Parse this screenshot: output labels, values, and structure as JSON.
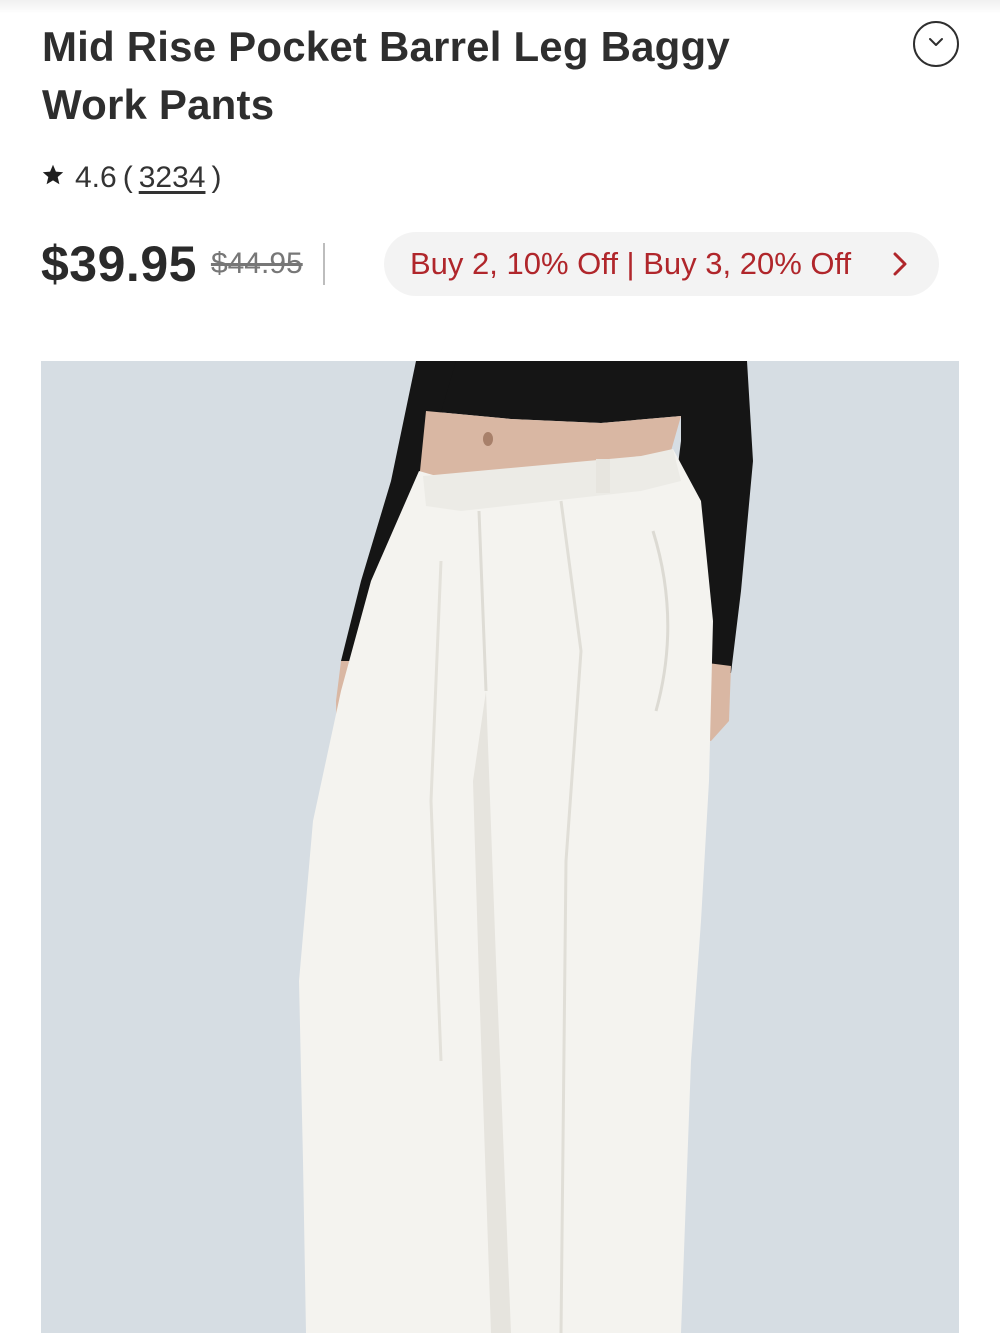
{
  "product": {
    "title": "Mid Rise Pocket Barrel Leg Baggy Work Pants",
    "rating": "4.6",
    "review_count": "3234",
    "price_current": "$39.95",
    "price_original": "$44.95",
    "promo_text": "Buy 2, 10% Off | Buy 3, 20% Off",
    "image_alt": "Model wearing white pleated barrel leg pants with black cropped cardigan"
  },
  "icons": {
    "collapse": "chevron-down-icon",
    "rating": "star-icon",
    "promo": "chevron-right-icon"
  },
  "colors": {
    "promo_text": "#b0262b",
    "promo_bg": "#f3f3f3",
    "image_bg": "#d6dde3"
  }
}
